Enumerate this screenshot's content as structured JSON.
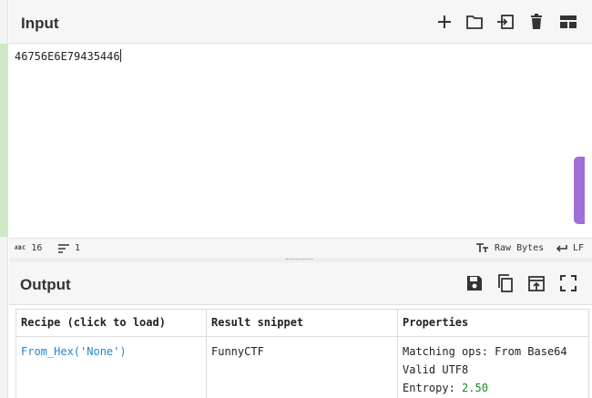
{
  "input": {
    "title": "Input",
    "text": "46756E6E79435446",
    "toolbar": [
      "plus-icon",
      "folder-icon",
      "import-icon",
      "trash-icon",
      "layout-icon"
    ]
  },
  "status": {
    "abc_label": "ABC",
    "length": "16",
    "lines": "1",
    "raw_bytes": "Raw Bytes",
    "eol": "LF"
  },
  "output": {
    "title": "Output",
    "toolbar": [
      "save-icon",
      "copy-icon",
      "replace-input-icon",
      "fullscreen-icon"
    ],
    "table": {
      "headers": [
        "Recipe (click to load)",
        "Result snippet",
        "Properties"
      ],
      "rows": [
        {
          "recipe": "From_Hex('None')",
          "snippet": "FunnyCTF",
          "properties": [
            "Matching ops: From Base64",
            "Valid UTF8"
          ],
          "entropy_label": "Entropy: ",
          "entropy_value": "2.50"
        }
      ]
    }
  },
  "colors": {
    "accent_link": "#1e88d6",
    "entropy_green": "#1a8a1a",
    "input_gutter_green": "#cfe8c6",
    "side_tab_purple": "#a06ed8"
  }
}
